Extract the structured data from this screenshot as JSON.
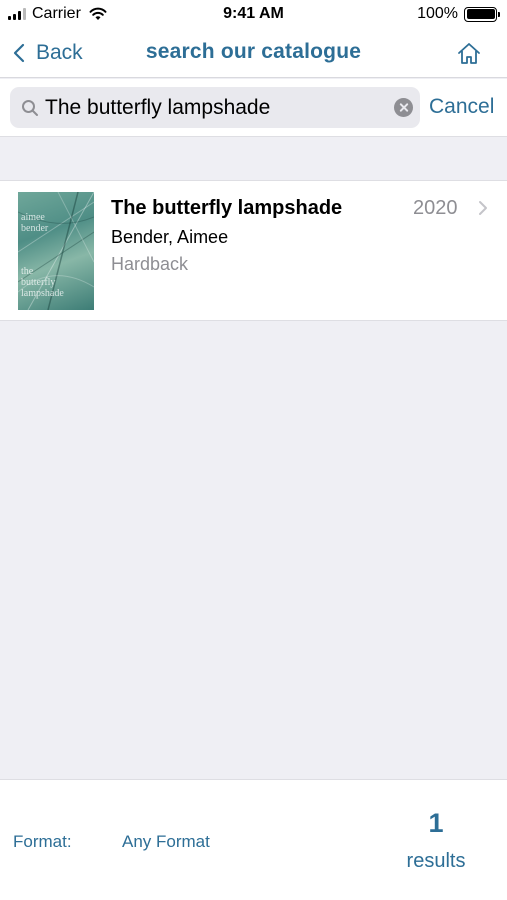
{
  "status_bar": {
    "carrier": "Carrier",
    "time": "9:41 AM",
    "battery": "100%",
    "icons": [
      "signal-icon",
      "wifi-icon",
      "battery-icon"
    ]
  },
  "nav": {
    "back_label": "Back",
    "title": "search our catalogue",
    "home_icon": "home-icon"
  },
  "search": {
    "value": "The butterfly lampshade",
    "cancel_label": "Cancel"
  },
  "results": [
    {
      "title": "The butterfly lampshade",
      "author": "Bender, Aimee",
      "format": "Hardback",
      "year": "2020",
      "cover_text": [
        "aimee",
        "bender",
        "the",
        "butterfly",
        "lampshade"
      ]
    }
  ],
  "footer": {
    "format_label": "Format:",
    "format_value": "Any Format",
    "results_count": "1",
    "results_label": "results"
  },
  "colors": {
    "accent": "#2d6e96",
    "background": "#efeff4",
    "secondary_text": "#8e8e93"
  }
}
